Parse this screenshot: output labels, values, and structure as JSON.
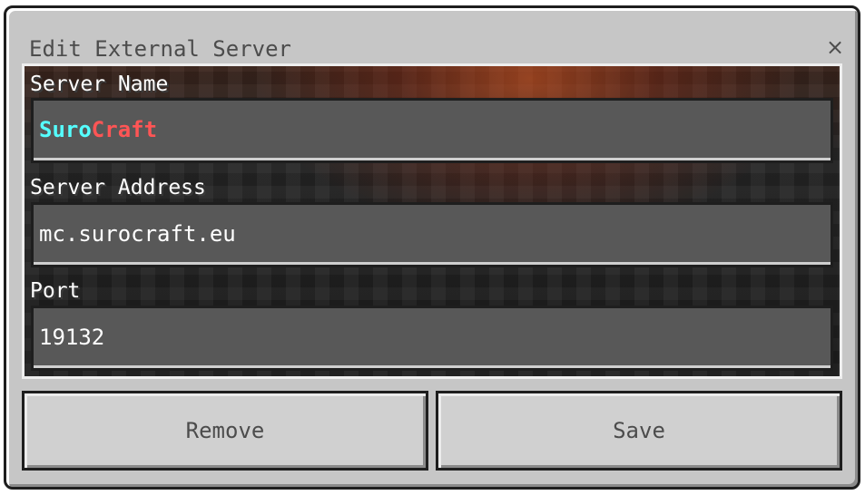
{
  "dialog": {
    "title": "Edit External Server",
    "close_glyph": "×"
  },
  "form": {
    "server_name": {
      "label": "Server Name",
      "value_parts": [
        {
          "text": "Suro",
          "color": "#55FFFF"
        },
        {
          "text": "Craft",
          "color": "#FF5555"
        }
      ]
    },
    "server_address": {
      "label": "Server Address",
      "value": "mc.surocraft.eu"
    },
    "port": {
      "label": "Port",
      "value": "19132"
    }
  },
  "buttons": {
    "remove_label": "Remove",
    "save_label": "Save"
  },
  "colors": {
    "panel": "#C6C6C6",
    "field": "#585858",
    "accent_aqua": "#55FFFF",
    "accent_red": "#FF5555"
  },
  "icons": {
    "close": "close-icon"
  }
}
